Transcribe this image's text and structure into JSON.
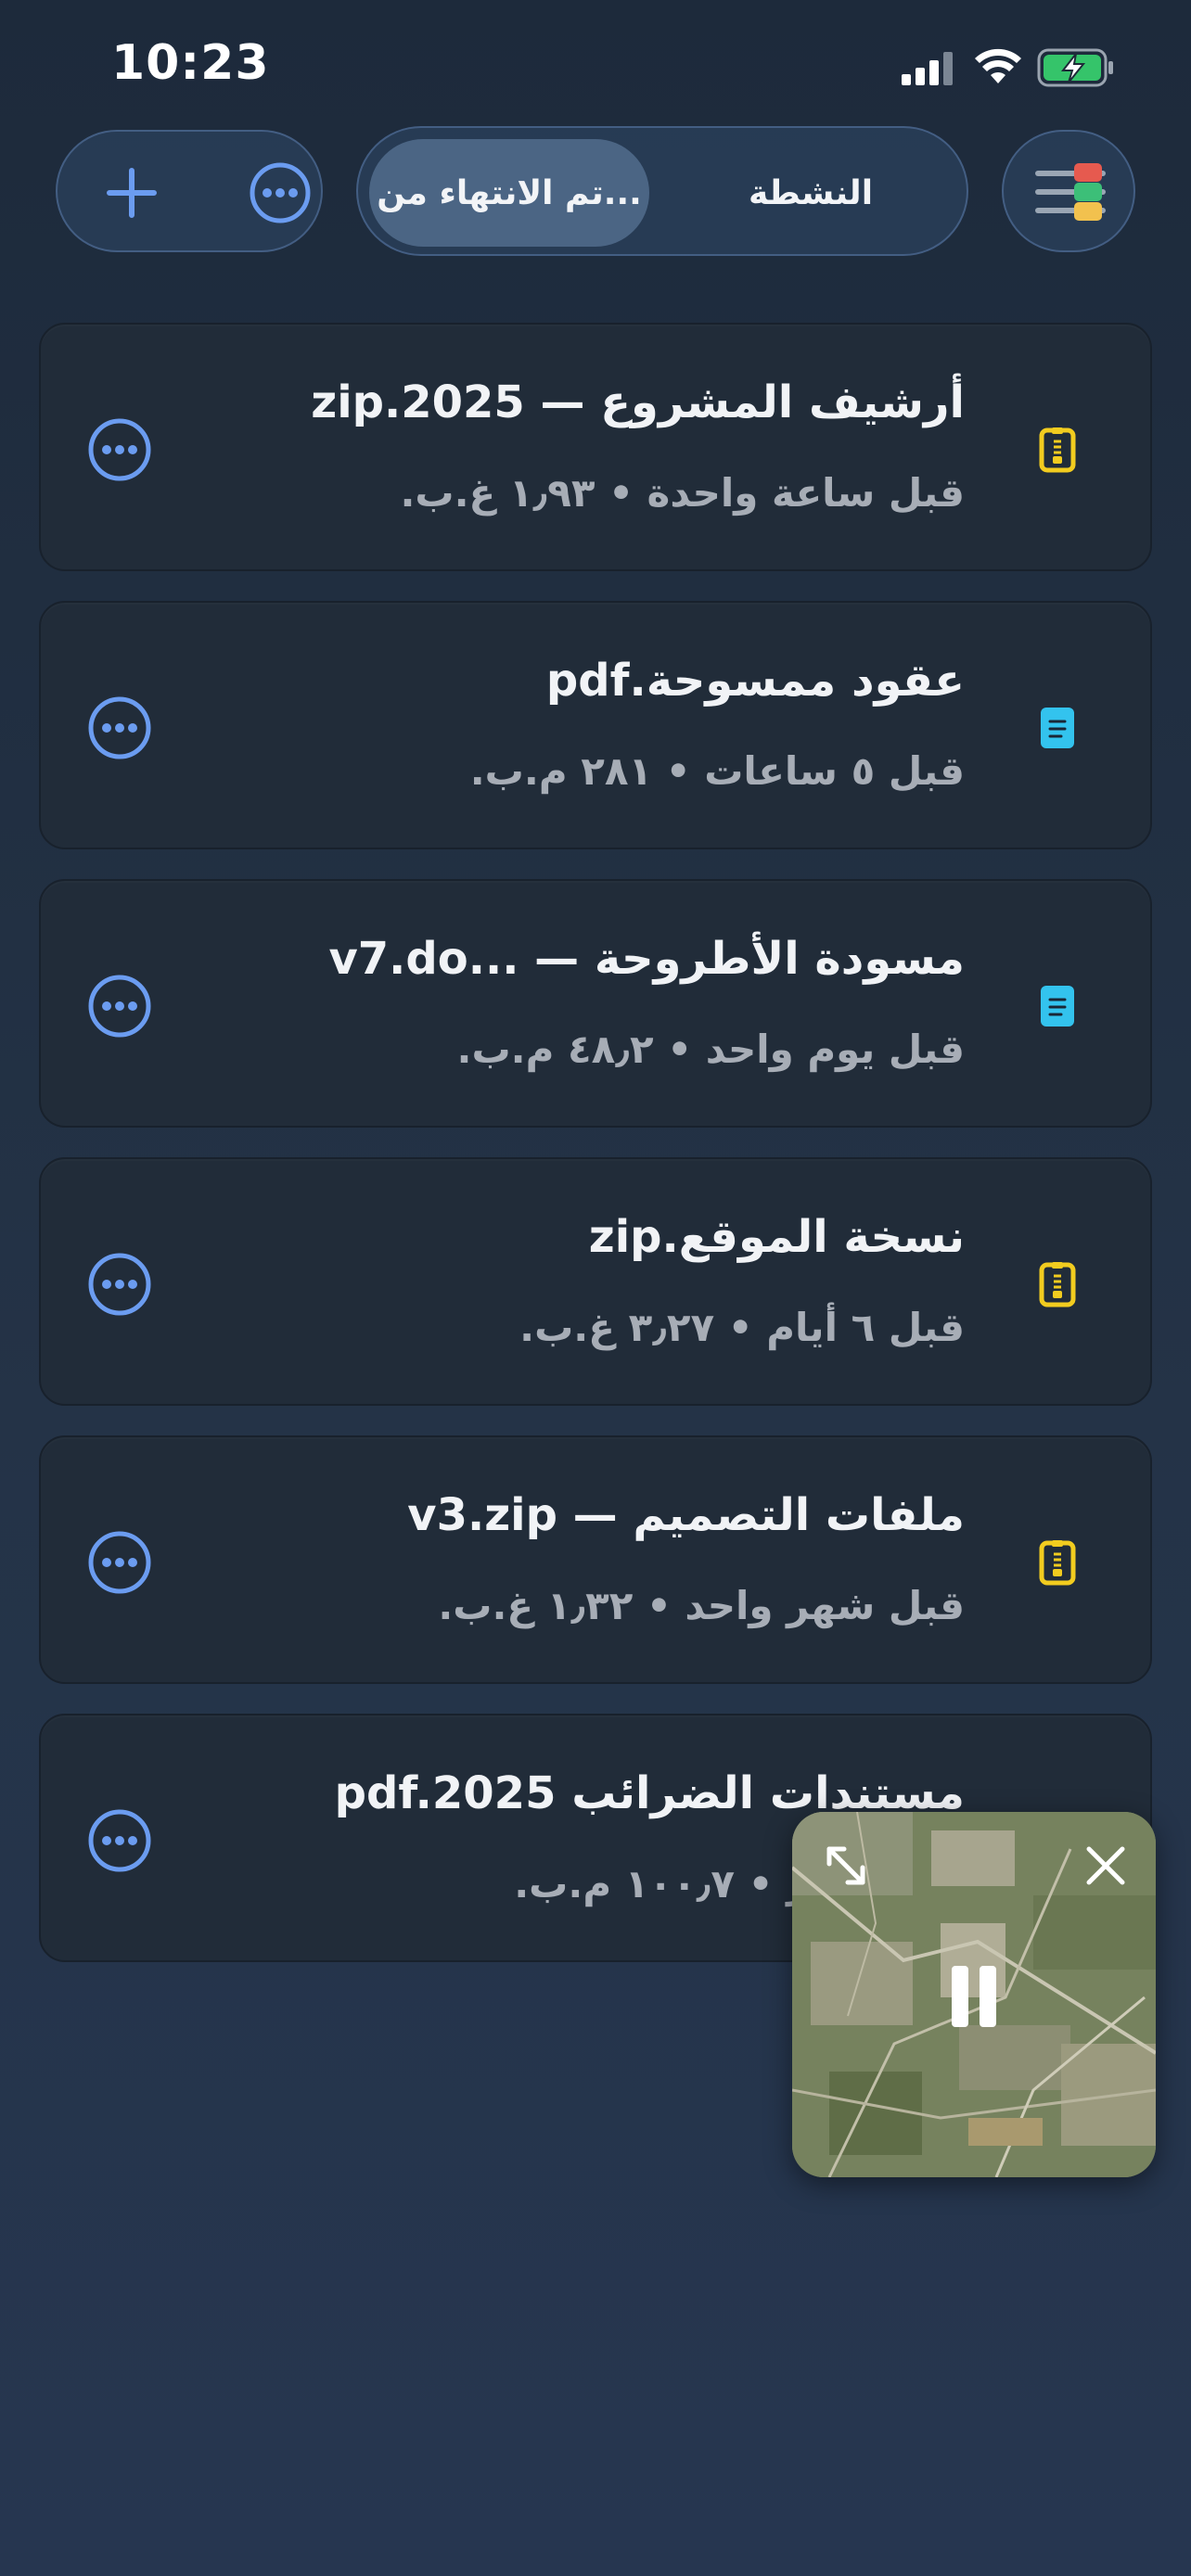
{
  "status_bar": {
    "time": "10:23",
    "battery_state": "charging"
  },
  "header": {
    "segments": [
      {
        "label": "تم الانتهاء من...",
        "active": true
      },
      {
        "label": "النشطة",
        "active": false
      }
    ]
  },
  "files": [
    {
      "title": "أرشيف المشروع — zip.2025",
      "meta": "قبل ساعة واحدة • ١٫٩٣ غ.ب.",
      "icon": "zip-file-icon"
    },
    {
      "title": "عقود ممسوحة.pdf",
      "meta": "قبل ٥ ساعات • ٢٨١ م.ب.",
      "icon": "document-file-icon"
    },
    {
      "title": "مسودة الأطروحة — ...v7.do",
      "meta": "قبل يوم واحد • ٤٨٫٢ م.ب.",
      "icon": "document-file-icon"
    },
    {
      "title": "نسخة الموقع.zip",
      "meta": "قبل ٦ أيام • ٣٫٢٧ غ.ب.",
      "icon": "zip-file-icon"
    },
    {
      "title": "ملفات التصميم — v3.zip",
      "meta": "قبل شهر واحد • ١٫٣٢ غ.ب.",
      "icon": "zip-file-icon"
    },
    {
      "title": "مستندات الضرائب pdf.2025",
      "meta": "قبل شهر • ١٠٠٫٧ م.ب.",
      "icon": "document-file-icon"
    }
  ],
  "pip": {
    "state": "playing"
  },
  "colors": {
    "accent_blue": "#6b9cf0",
    "zip_icon": "#f2cc1f",
    "doc_icon": "#33c3ee",
    "card_bg": "#212c39",
    "menu_red": "#e65a4f",
    "menu_green": "#3cbf78",
    "menu_yellow": "#f2c14e"
  }
}
